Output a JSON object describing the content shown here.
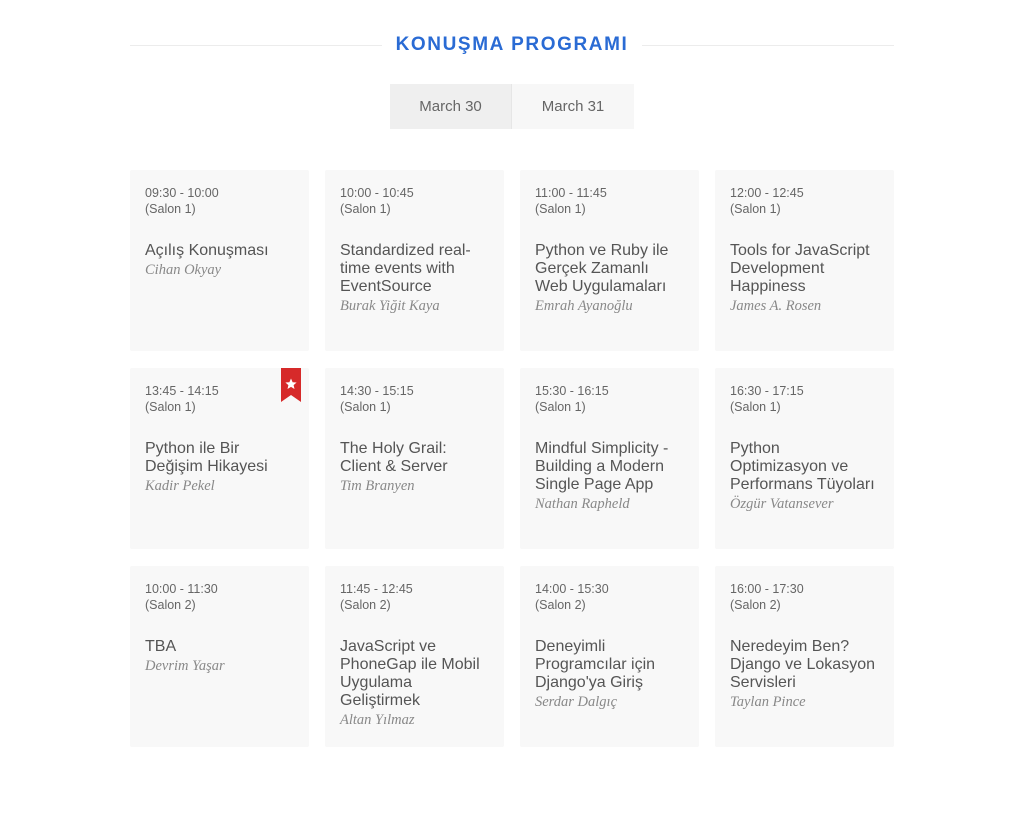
{
  "header": {
    "title": "KONUŞMA PROGRAMI"
  },
  "tabs": [
    {
      "label": "March 30",
      "active": true
    },
    {
      "label": "March 31",
      "active": false
    }
  ],
  "colors": {
    "accent": "#2a6bd4",
    "bookmark": "#d62a2a"
  },
  "talks": [
    {
      "time": "09:30 - 10:00",
      "room": "(Salon 1)",
      "title": "Açılış Konuşması",
      "speaker": "Cihan Okyay",
      "bookmarked": false
    },
    {
      "time": "10:00 - 10:45",
      "room": "(Salon 1)",
      "title": "Standardized real-time events with EventSource",
      "speaker": "Burak Yiğit Kaya",
      "bookmarked": false
    },
    {
      "time": "11:00 - 11:45",
      "room": "(Salon 1)",
      "title": "Python ve Ruby ile Gerçek Zamanlı Web Uygulamaları",
      "speaker": "Emrah Ayanoğlu",
      "bookmarked": false
    },
    {
      "time": "12:00 - 12:45",
      "room": "(Salon 1)",
      "title": "Tools for JavaScript Development Happiness",
      "speaker": "James A. Rosen",
      "bookmarked": false
    },
    {
      "time": "13:45 - 14:15",
      "room": "(Salon 1)",
      "title": "Python ile Bir Değişim Hikayesi",
      "speaker": "Kadir Pekel",
      "bookmarked": true
    },
    {
      "time": "14:30 - 15:15",
      "room": "(Salon 1)",
      "title": "The Holy Grail: Client & Server",
      "speaker": "Tim Branyen",
      "bookmarked": false
    },
    {
      "time": "15:30 - 16:15",
      "room": "(Salon 1)",
      "title": "Mindful Simplicity - Building a Modern Single Page App",
      "speaker": "Nathan Rapheld",
      "bookmarked": false
    },
    {
      "time": "16:30 - 17:15",
      "room": "(Salon 1)",
      "title": "Python Optimizasyon ve Performans Tüyoları",
      "speaker": "Özgür Vatansever",
      "bookmarked": false
    },
    {
      "time": "10:00 - 11:30",
      "room": "(Salon 2)",
      "title": "TBA",
      "speaker": "Devrim Yaşar",
      "bookmarked": false
    },
    {
      "time": "11:45 - 12:45",
      "room": "(Salon 2)",
      "title": "JavaScript ve PhoneGap ile Mobil Uygulama Geliştirmek",
      "speaker": "Altan Yılmaz",
      "bookmarked": false
    },
    {
      "time": "14:00 - 15:30",
      "room": "(Salon 2)",
      "title": "Deneyimli Programcılar için Django'ya Giriş",
      "speaker": "Serdar Dalgıç",
      "bookmarked": false
    },
    {
      "time": "16:00 - 17:30",
      "room": "(Salon 2)",
      "title": "Neredeyim Ben? Django ve Lokasyon Servisleri",
      "speaker": "Taylan Pince",
      "bookmarked": false
    }
  ]
}
